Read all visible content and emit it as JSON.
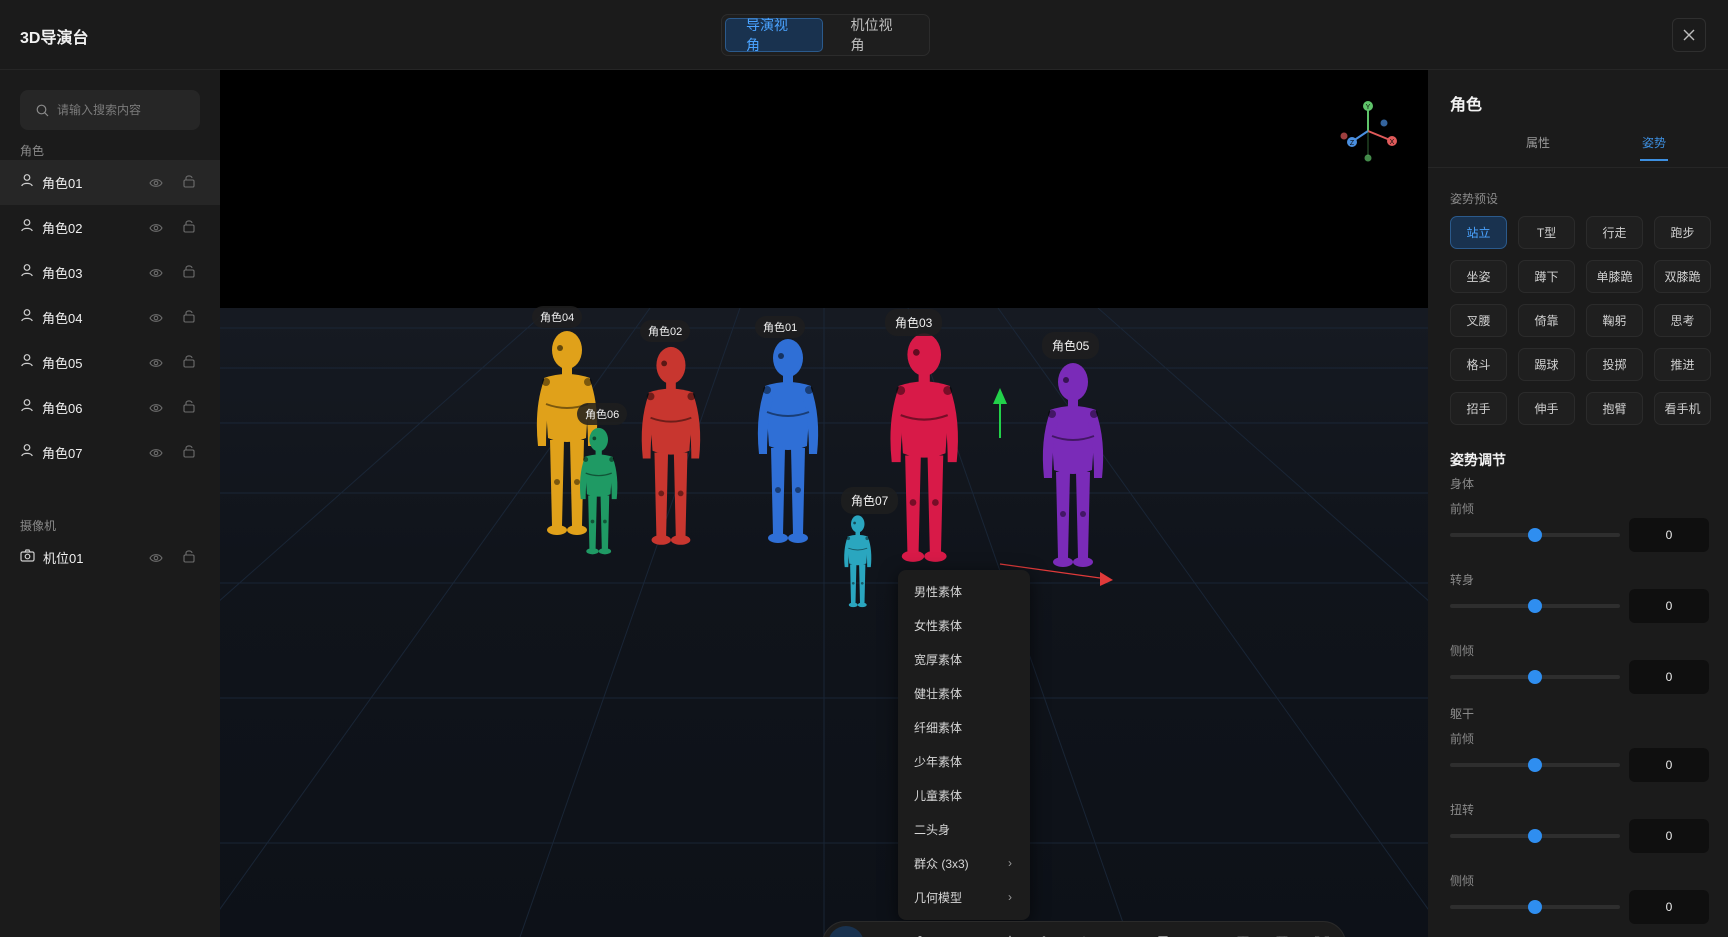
{
  "header": {
    "app_title": "3D导演台",
    "view_tabs": [
      "导演视角",
      "机位视角"
    ],
    "active_view": 0
  },
  "sidebar": {
    "search_placeholder": "请输入搜索内容",
    "roles_label": "角色",
    "roles": [
      "角色01",
      "角色02",
      "角色03",
      "角色04",
      "角色05",
      "角色06",
      "角色07"
    ],
    "selected_role": 0,
    "cameras_label": "摄像机",
    "cameras": [
      "机位01"
    ]
  },
  "viewport": {
    "character_tags": [
      "角色04",
      "角色02",
      "角色01",
      "角色03",
      "角色05",
      "角色06",
      "角色07"
    ],
    "context_menu": [
      "男性素体",
      "女性素体",
      "宽厚素体",
      "健壮素体",
      "纤细素体",
      "少年素体",
      "儿童素体",
      "二头身",
      "群众 (3x3)",
      "几何模型"
    ],
    "axis_labels": {
      "x": "X",
      "y": "Y",
      "z": "Z"
    },
    "toolbar_icons": [
      "move-gizmo-icon",
      "rotate-icon",
      "bone-icon",
      "add-character-icon",
      "add-image-icon",
      "cube-icon",
      "group-icon",
      "video-camera-icon",
      "frame-icon",
      "camera-icon",
      "grid-view-icon",
      "table-grid-icon",
      "fullscreen-icon"
    ],
    "active_tool": 0
  },
  "right_panel": {
    "title": "角色",
    "tabs": [
      "属性",
      "姿势"
    ],
    "active_tab": 1,
    "preset_label": "姿势预设",
    "presets": [
      "站立",
      "T型",
      "行走",
      "跑步",
      "坐姿",
      "蹲下",
      "单膝跪",
      "双膝跪",
      "叉腰",
      "倚靠",
      "鞠躬",
      "思考",
      "格斗",
      "踢球",
      "投掷",
      "推进",
      "招手",
      "伸手",
      "抱臂",
      "看手机"
    ],
    "active_preset": 0,
    "adjust_heading": "姿势调节",
    "groups": [
      {
        "label": "身体",
        "controls": [
          {
            "name": "前倾",
            "value": "0"
          },
          {
            "name": "转身",
            "value": "0"
          },
          {
            "name": "侧倾",
            "value": "0"
          }
        ]
      },
      {
        "label": "躯干",
        "controls": [
          {
            "name": "前倾",
            "value": "0"
          },
          {
            "name": "扭转",
            "value": "0"
          },
          {
            "name": "侧倾",
            "value": "0"
          }
        ]
      }
    ],
    "slider_level": 0.5
  },
  "colors": {
    "accent": "#2f8ef0",
    "char_01": "#2f6fd6",
    "char_02": "#c8362f",
    "char_03": "#d81a48",
    "char_04": "#e0a11a",
    "char_05": "#7a2bb8",
    "char_06": "#1f9a64",
    "char_07": "#2aa6bf"
  }
}
